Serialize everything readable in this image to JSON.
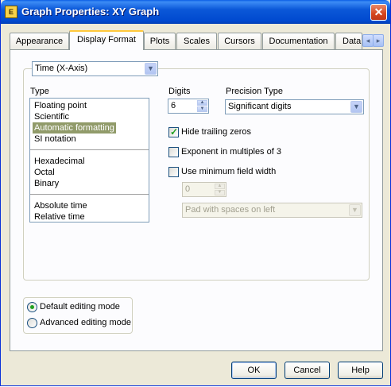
{
  "window": {
    "title": "Graph Properties: XY Graph",
    "icon_text": "E",
    "close_symbol": "✕"
  },
  "tabs": [
    {
      "label": "Appearance",
      "active": false
    },
    {
      "label": "Display Format",
      "active": true
    },
    {
      "label": "Plots",
      "active": false
    },
    {
      "label": "Scales",
      "active": false
    },
    {
      "label": "Cursors",
      "active": false
    },
    {
      "label": "Documentation",
      "active": false
    },
    {
      "label": "Data",
      "active": false
    }
  ],
  "tab_scroll": {
    "left": "◂",
    "right": "▸"
  },
  "display_format": {
    "axis_select": "Time (X-Axis)",
    "type_label": "Type",
    "type_groups": [
      [
        "Floating point",
        "Scientific",
        "Automatic formatting",
        "SI notation"
      ],
      [
        "Hexadecimal",
        "Octal",
        "Binary"
      ],
      [
        "Absolute time",
        "Relative time"
      ]
    ],
    "selected_type": "Automatic formatting",
    "digits_label": "Digits",
    "digits_value": "6",
    "precision_label": "Precision Type",
    "precision_value": "Significant digits",
    "hide_trailing_zeros": {
      "label": "Hide trailing zeros",
      "checked": true
    },
    "exponent_multiples": {
      "label": "Exponent in multiples of 3",
      "checked": false
    },
    "min_field_width": {
      "label": "Use minimum field width",
      "checked": false
    },
    "min_width_value": "0",
    "pad_option": "Pad with spaces on left"
  },
  "editing_mode": {
    "default_label": "Default editing mode",
    "advanced_label": "Advanced editing mode",
    "selected": "default"
  },
  "buttons": {
    "ok": "OK",
    "cancel": "Cancel",
    "help": "Help"
  },
  "colors": {
    "title_bar": "#0054e3",
    "selection": "#919b6a",
    "check": "#21a121",
    "active_tab": "#ffc83c"
  }
}
